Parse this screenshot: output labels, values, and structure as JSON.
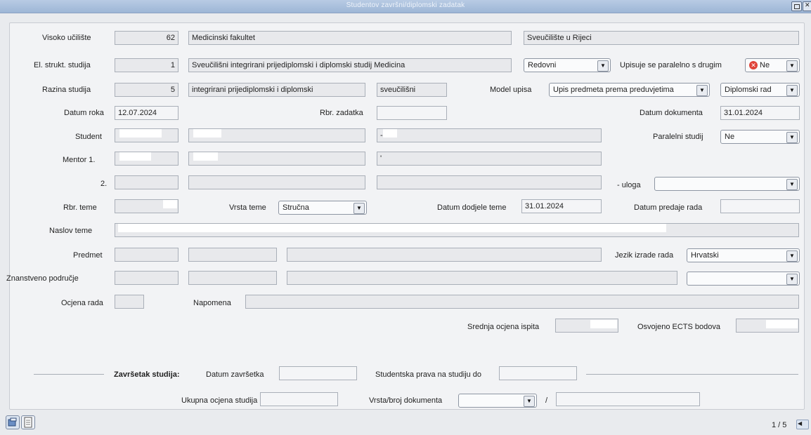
{
  "window": {
    "title": "Studentov završni/diplomski zadatak"
  },
  "row1": {
    "label": "Visoko učilište",
    "code": "62",
    "name": "Medicinski fakultet",
    "university": "Sveučilište u Rijeci"
  },
  "row2": {
    "label": "El. strukt. studija",
    "code": "1",
    "name": "Sveučilišni integrirani prijediplomski i diplomski studij Medicina",
    "study_mode": "Redovni",
    "parallel_label": "Upisuje se paralelno s drugim",
    "parallel_value": "Ne"
  },
  "row3": {
    "label": "Razina studija",
    "code": "5",
    "name": "integrirani prijediplomski i diplomski",
    "type": "sveučilišni",
    "model_label": "Model upisa",
    "model_value": "Upis predmeta prema preduvjetima",
    "work_type": "Diplomski rad"
  },
  "row4": {
    "deadline_label": "Datum roka",
    "deadline_value": "12.07.2024",
    "task_no_label": "Rbr. zadatka",
    "task_no_value": "",
    "doc_date_label": "Datum dokumenta",
    "doc_date_value": "31.01.2024"
  },
  "row5": {
    "label": "Student",
    "dash": "-",
    "parallel_study_label": "Paralelni studij",
    "parallel_study_value": "Ne"
  },
  "row6": {
    "label": "Mentor 1.",
    "tick": "'"
  },
  "row7": {
    "label": "2.",
    "role_label": "- uloga",
    "role_value": ""
  },
  "row8": {
    "topic_no_label": "Rbr. teme",
    "topic_type_label": "Vrsta teme",
    "topic_type_value": "Stručna",
    "assign_date_label": "Datum dodjele teme",
    "assign_date_value": "31.01.2024",
    "submit_date_label": "Datum predaje rada",
    "submit_date_value": ""
  },
  "row9": {
    "label": "Naslov teme"
  },
  "row10": {
    "label": "Predmet",
    "lang_label": "Jezik izrade rada",
    "lang_value": "Hrvatski"
  },
  "row11": {
    "label": "Znanstveno područje",
    "combo_value": ""
  },
  "row12": {
    "grade_label": "Ocjena rada",
    "note_label": "Napomena"
  },
  "row13": {
    "avg_label": "Srednja ocjena ispita",
    "ects_label": "Osvojeno ECTS bodova"
  },
  "completion": {
    "header": "Završetak studija:",
    "end_date_label": "Datum završetka",
    "rights_label": "Studentska prava na studiju do",
    "total_grade_label": "Ukupna ocjena studija",
    "doc_type_label": "Vrsta/broj dokumenta",
    "slash": "/"
  },
  "status": {
    "page_indicator": "1 / 5"
  }
}
